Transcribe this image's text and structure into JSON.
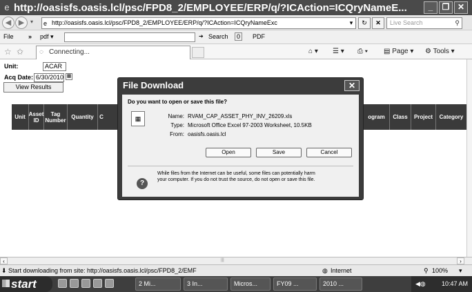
{
  "window": {
    "title": "http://oasisfs.oasis.lcl/psc/FPD8_2/EMPLOYEE/ERP/q/?ICAction=ICQryNameE...",
    "minimize": "_",
    "restore": "❐",
    "close": "✕"
  },
  "address_bar": {
    "url": "http://oasisfs.oasis.lcl/psc/FPD8_2/EMPLOYEE/ERP/q/?ICAction=ICQryNameExc",
    "search_placeholder": "Live Search"
  },
  "toolbar": {
    "file": "File",
    "chevron": "»",
    "pdf": "pdf ▾",
    "search": "Search",
    "search_count": "0",
    "pdf_button": "PDF"
  },
  "tabs": {
    "current": "Connecting...",
    "page_menu": "Page ▾",
    "tools_menu": "Tools ▾"
  },
  "query": {
    "unit_label": "Unit:",
    "unit_value": "ACAR",
    "acq_label": "Acq Date:",
    "acq_value": "6/30/2010",
    "view_results": "View Results",
    "columns": [
      "Unit",
      "Asset ID",
      "Tag Number",
      "Quantity",
      "C",
      "ogram",
      "Class",
      "Project",
      "Category"
    ]
  },
  "dialog": {
    "title": "File Download",
    "question": "Do you want to open or save this file?",
    "name_label": "Name:",
    "name_value": "RVAM_CAP_ASSET_PHY_INV_26209.xls",
    "type_label": "Type:",
    "type_value": "Microsoft Office Excel 97-2003 Worksheet, 10.5KB",
    "from_label": "From:",
    "from_value": "oasisfs.oasis.lcl",
    "open": "Open",
    "save": "Save",
    "cancel": "Cancel",
    "warning_line1": "While files from the Internet can be useful, some files can potentially harm",
    "warning_line2": "your computer. If you do not trust the source, do not open or save this file."
  },
  "status": {
    "text": "Start downloading from site: http://oasisfs.oasis.lcl/psc/FPD8_2/EMF",
    "zone": "Internet",
    "zoom": "100%"
  },
  "taskbar": {
    "start": "start",
    "items": [
      "2 Mi...",
      "3 In...",
      "Micros...",
      "FY09 ...",
      "2010 ..."
    ],
    "clock": "10:47 AM"
  }
}
